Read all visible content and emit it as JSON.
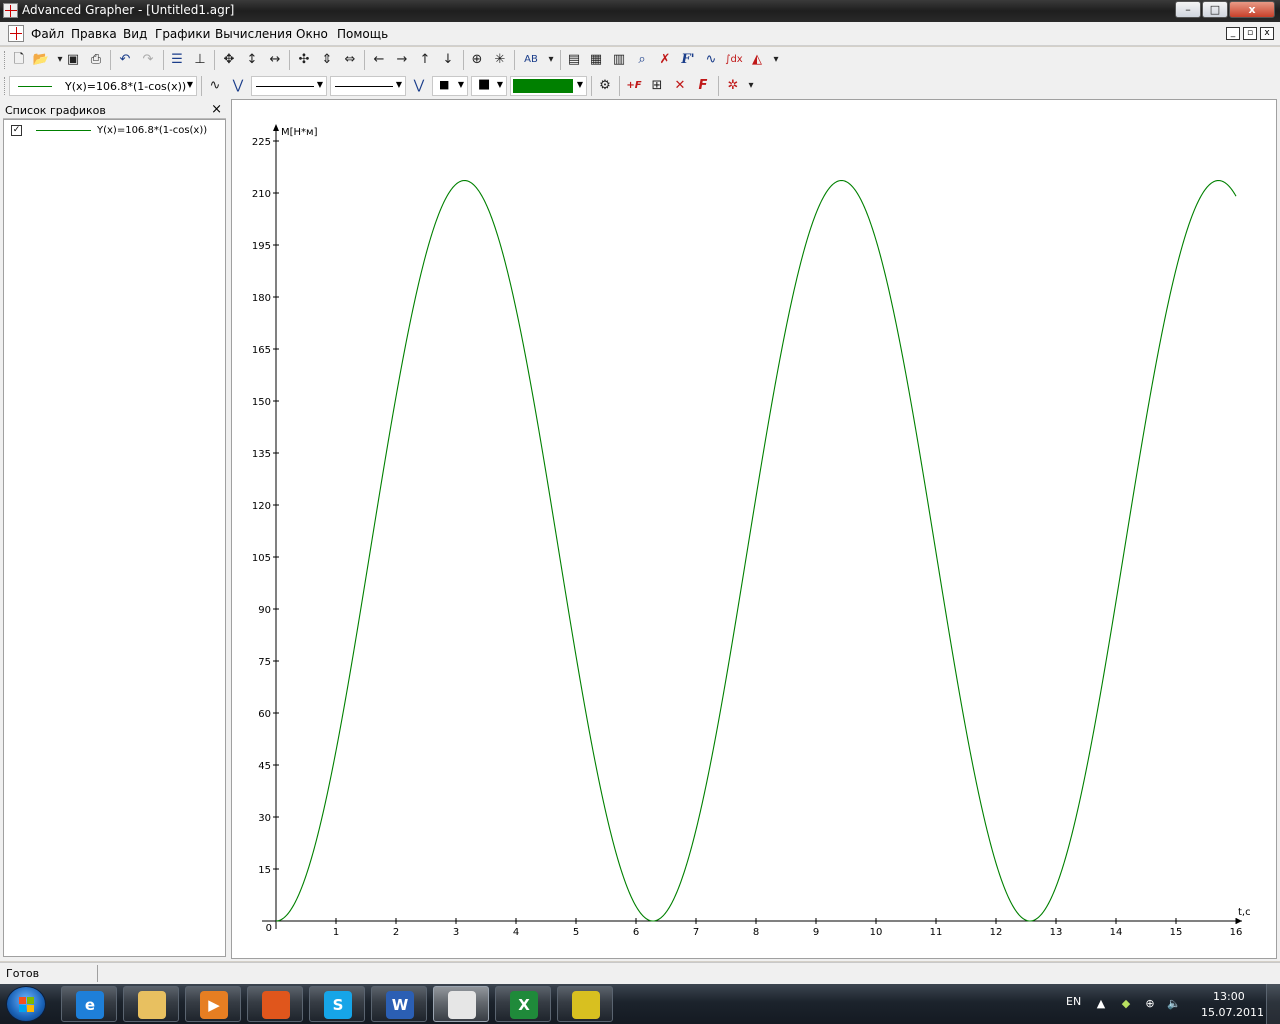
{
  "window": {
    "title": "Advanced Grapher - [Untitled1.agr]",
    "minimize_label": "–",
    "maximize_label": "□",
    "close_label": "x"
  },
  "menu": {
    "items": [
      "Файл",
      "Правка",
      "Вид",
      "Графики",
      "Вычисления",
      "Окно",
      "Помощь"
    ],
    "mdi_buttons": [
      "_",
      "▫",
      "x"
    ]
  },
  "toolbar1": {
    "icons": [
      "new-icon",
      "open-icon",
      "save-icon",
      "print-icon",
      "undo-icon",
      "redo-icon",
      "list-icon",
      "axes-icon",
      "move-icon",
      "vertical-resize-icon",
      "horizontal-resize-icon",
      "zoom-in-icon",
      "zoom-v-icon",
      "zoom-h-icon",
      "left-arrow-icon",
      "right-arrow-icon",
      "up-arrow-icon",
      "down-arrow-icon",
      "center-icon",
      "fit-icon",
      "label-icon",
      "table-icon",
      "calculator-icon",
      "grid-icon",
      "search-icon",
      "intersect-icon",
      "derivative-icon",
      "tangent-icon",
      "integral-icon",
      "area-icon"
    ],
    "label_text": "AB",
    "derivative_text": "F'",
    "integral_text": "∫dx"
  },
  "toolbar2": {
    "graph_select": "Y(x)=106.8*(1-cos(x))",
    "line_color": "#008000",
    "add_graph_text": "+F",
    "delete_graph_text": "✕",
    "format_graph_text": "F"
  },
  "graph_panel": {
    "title": "Список графиков",
    "close_label": "×",
    "items": [
      {
        "label": "Y(x)=106.8*(1-cos(x))",
        "checked": true,
        "color": "#008000"
      }
    ]
  },
  "chart_data": {
    "type": "line",
    "function": "Y(x)=106.8*(1-cos(x))",
    "amplitude": 106.8,
    "xlabel": "t,c",
    "ylabel": "M[H*м]",
    "xlim": [
      0,
      16
    ],
    "ylim": [
      0,
      225
    ],
    "x_ticks": [
      0,
      1,
      2,
      3,
      4,
      5,
      6,
      7,
      8,
      9,
      10,
      11,
      12,
      13,
      14,
      15,
      16
    ],
    "y_ticks": [
      15,
      30,
      45,
      60,
      75,
      90,
      105,
      120,
      135,
      150,
      165,
      180,
      195,
      210,
      225
    ],
    "origin_label": "0",
    "series": [
      {
        "color": "#008000",
        "x_range": [
          0,
          16
        ],
        "formula": "106.8*(1-cos(x))"
      }
    ],
    "grid": false,
    "legend": "none"
  },
  "status": {
    "text": "Готов"
  },
  "taskbar": {
    "apps": [
      {
        "name": "internet-explorer",
        "glyph": "e",
        "color": "#1e7fd8"
      },
      {
        "name": "file-explorer",
        "glyph": "",
        "color": "#e8c060"
      },
      {
        "name": "media-player",
        "glyph": "▶",
        "color": "#e67e22"
      },
      {
        "name": "firefox",
        "glyph": "",
        "color": "#e0561c"
      },
      {
        "name": "skype",
        "glyph": "S",
        "color": "#16a5e8"
      },
      {
        "name": "word",
        "glyph": "W",
        "color": "#2b5fb4"
      },
      {
        "name": "advanced-grapher",
        "glyph": "",
        "color": "#e6e6e6"
      },
      {
        "name": "excel",
        "glyph": "X",
        "color": "#1f8a3a"
      },
      {
        "name": "other-app",
        "glyph": "",
        "color": "#d8c020"
      }
    ],
    "lang": "EN",
    "time": "13:00",
    "date": "15.07.2011"
  }
}
